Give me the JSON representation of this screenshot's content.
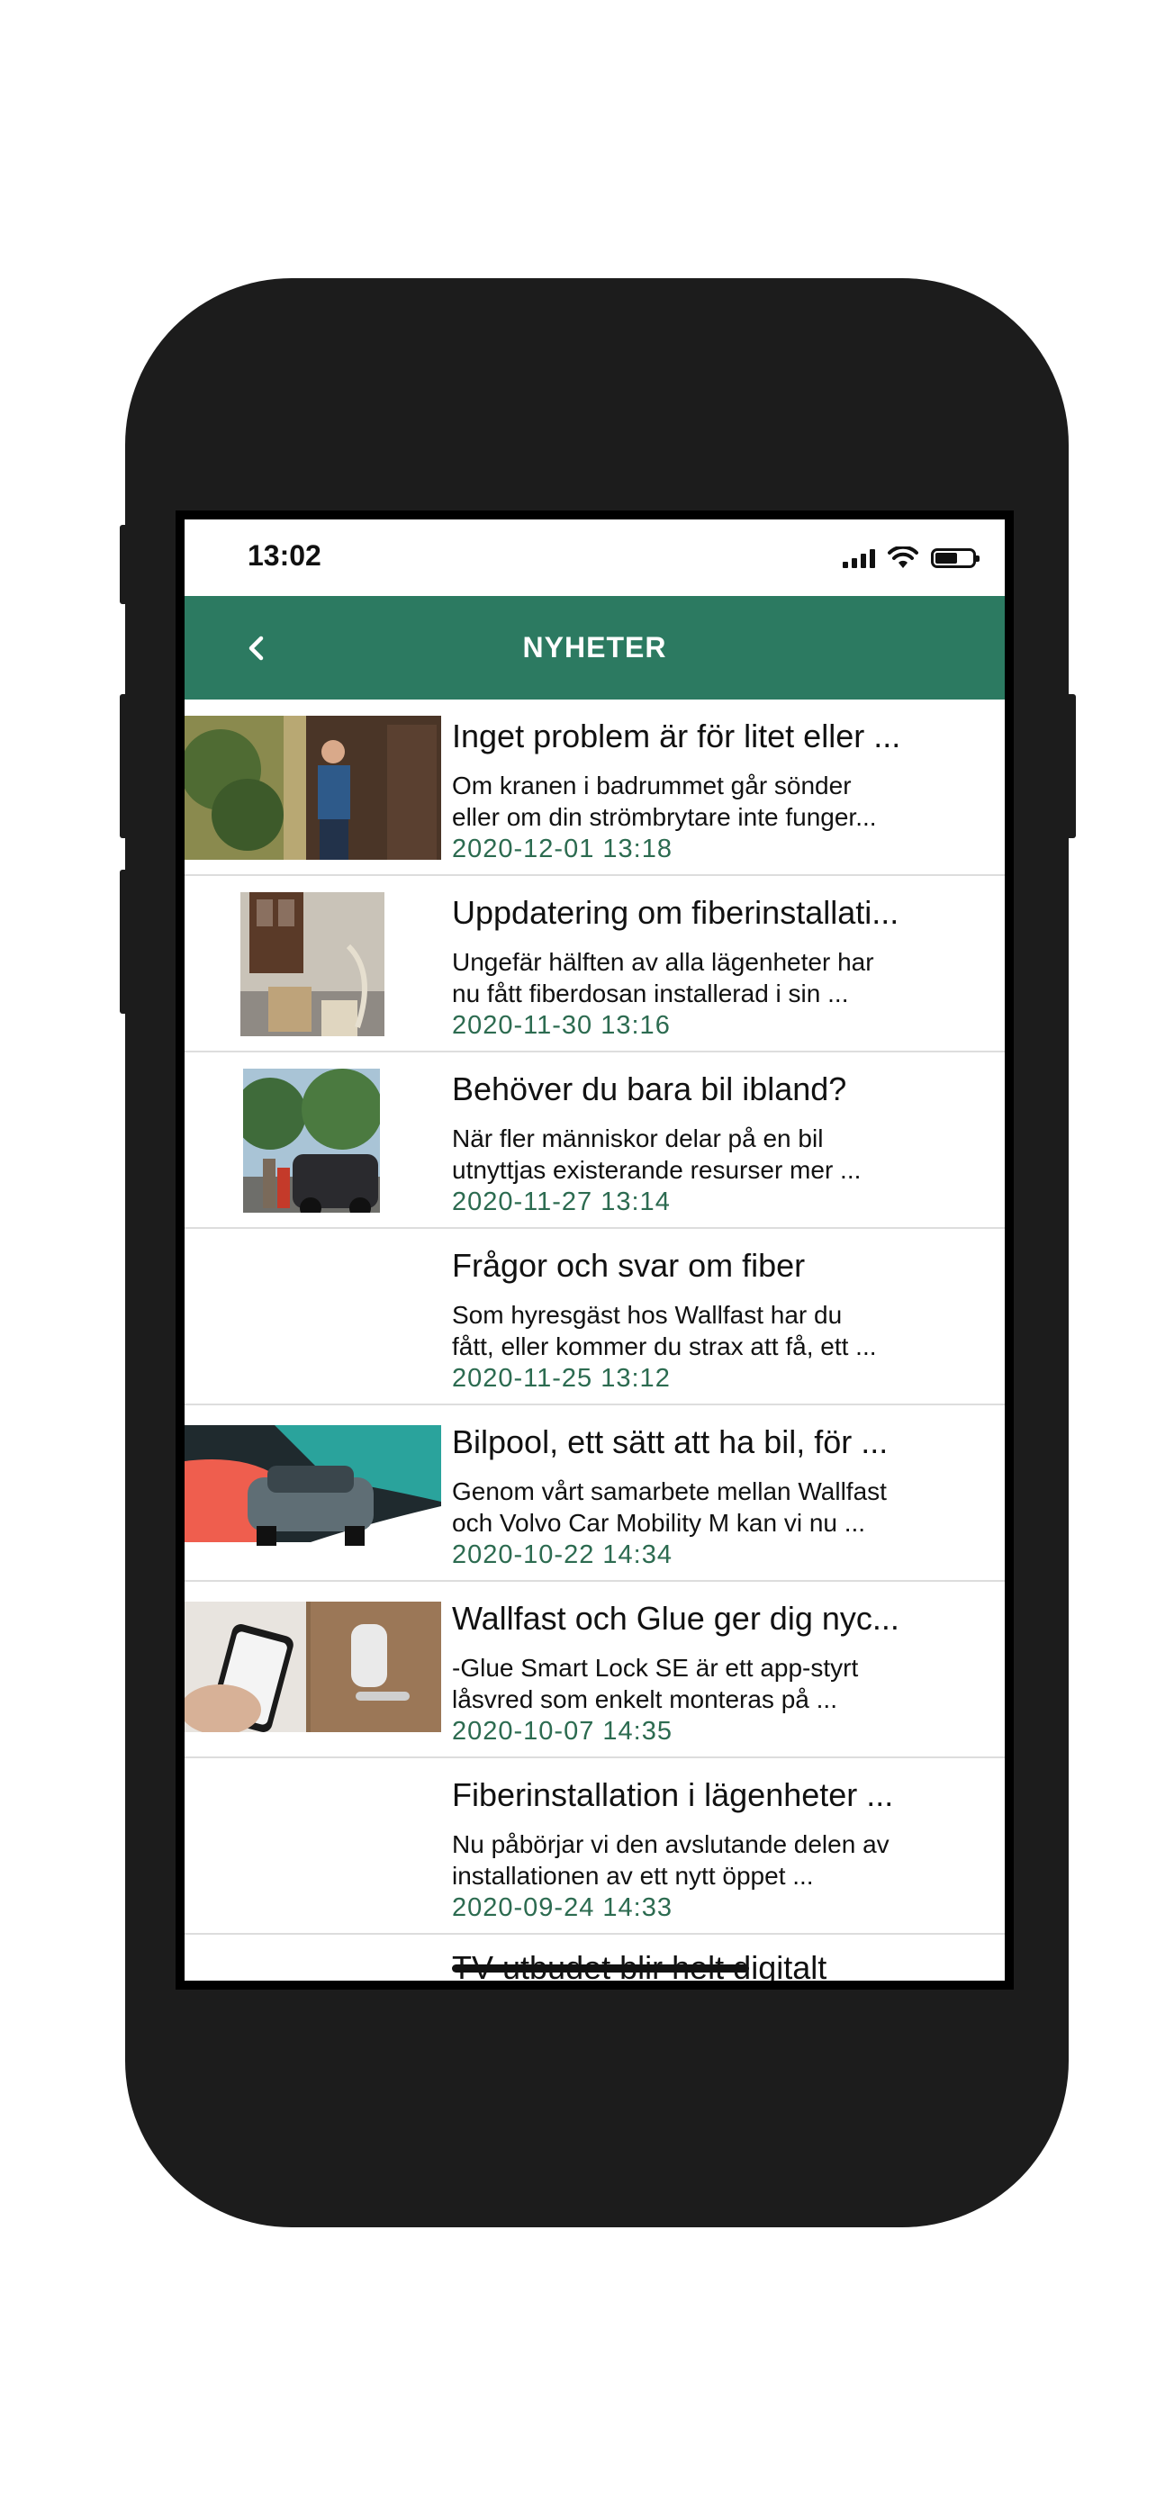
{
  "status_bar": {
    "time": "13:02"
  },
  "header": {
    "title": "NYHETER"
  },
  "news": [
    {
      "title": "Inget problem är för litet eller ...",
      "excerpt_line1": "Om kranen i badrummet går sönder",
      "excerpt_line2": "eller om din strömbrytare inte funger...",
      "date": "2020-12-01 13:18"
    },
    {
      "title": "Uppdatering om fiberinstallati...",
      "excerpt_line1": "Ungefär hälften av alla lägenheter har",
      "excerpt_line2": "nu fått fiberdosan installerad i sin ...",
      "date": "2020-11-30 13:16"
    },
    {
      "title": "Behöver du bara bil ibland?",
      "excerpt_line1": "När fler människor delar på en bil",
      "excerpt_line2": "utnyttjas existerande resurser mer ...",
      "date": "2020-11-27 13:14"
    },
    {
      "title": "Frågor och svar om fiber",
      "excerpt_line1": "Som hyresgäst hos Wallfast har du",
      "excerpt_line2": "fått, eller kommer du strax att få, ett ...",
      "date": "2020-11-25 13:12"
    },
    {
      "title": "Bilpool, ett sätt att ha bil, för ...",
      "excerpt_line1": "Genom vårt samarbete mellan Wallfast",
      "excerpt_line2": "och Volvo Car Mobility M kan vi nu ...",
      "date": "2020-10-22 14:34"
    },
    {
      "title": "Wallfast och Glue ger dig nyc...",
      "excerpt_line1": "-Glue Smart Lock SE är ett app-styrt",
      "excerpt_line2": "låsvred som enkelt monteras på ...",
      "date": "2020-10-07 14:35"
    },
    {
      "title": "Fiberinstallation i lägenheter ...",
      "excerpt_line1": "Nu påbörjar vi den avslutande delen av",
      "excerpt_line2": "installationen av ett nytt öppet ...",
      "date": "2020-09-24 14:33"
    }
  ],
  "partial_item": {
    "title": "TV-utbudet blir helt digitalt"
  },
  "colors": {
    "accent": "#2c7a61",
    "date": "#2c6b50",
    "phone_body": "#1c1c1c"
  }
}
